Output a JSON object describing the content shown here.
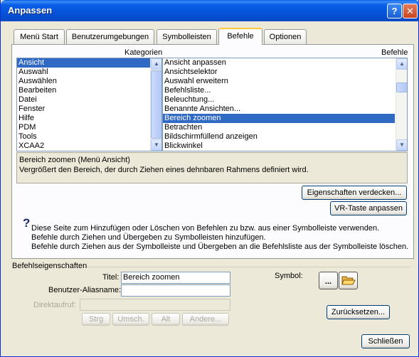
{
  "window": {
    "title": "Anpassen",
    "help_label": "?",
    "close_label": "✕"
  },
  "tabs": [
    {
      "label": "Menü Start"
    },
    {
      "label": "Benutzerumgebungen"
    },
    {
      "label": "Symbolleisten"
    },
    {
      "label": "Befehle"
    },
    {
      "label": "Optionen"
    }
  ],
  "categories": {
    "header": "Kategorien",
    "items": [
      "Ansicht",
      "Auswahl",
      "Auswählen",
      "Bearbeiten",
      "Datei",
      "Fenster",
      "Hilfe",
      "PDM",
      "Tools",
      "XCAA2"
    ],
    "selected": "Ansicht"
  },
  "commands": {
    "header": "Befehle",
    "items": [
      "Ansicht anpassen",
      "Ansichtselektor",
      "Auswahl erweitern",
      "Befehlsliste...",
      "Beleuchtung...",
      "Benannte Ansichten...",
      "Bereich zoomen",
      "Betrachten",
      "Bildschirmfüllend anzeigen",
      "Blickwinkel"
    ],
    "selected": "Bereich zoomen"
  },
  "description": {
    "line1": "Bereich zoomen (Menü Ansicht)",
    "line2": "Vergrößert den Bereich, der durch Ziehen eines dehnbaren Rahmens definiert wird."
  },
  "buttons": {
    "hide_properties": "Eigenschaften verdecken...",
    "vr_key": "VR-Taste anpassen",
    "reset": "Zurücksetzen...",
    "close": "Schließen",
    "more": "...",
    "ctrl": "Strg",
    "shift": "Umsch.",
    "alt": "Alt",
    "other": "Andere..."
  },
  "help": {
    "icon": "question-icon",
    "line1": "Diese Seite zum Hinzufügen oder Löschen von Befehlen zu bzw. aus einer Symbolleiste verwenden.",
    "line2": "Befehle durch Ziehen und Übergeben zu Symbolleisten hinzufügen.",
    "line3": "Befehle durch Ziehen aus der Symbolleiste und Übergeben an die Befehlsliste aus der Symbolleiste löschen."
  },
  "properties": {
    "group_title": "Befehlseigenschaften",
    "title_label": "Titel:",
    "title_value": "Bereich zoomen",
    "alias_label": "Benutzer-Aliasname:",
    "alias_value": "",
    "shortcut_label": "Direktaufruf:",
    "shortcut_value": "",
    "symbol_label": "Symbol:",
    "symbol_icon": "folder-open-icon"
  },
  "colors": {
    "title_bar": "#0553d8",
    "selection": "#316ac5",
    "dialog_bg": "#ece9d8"
  }
}
